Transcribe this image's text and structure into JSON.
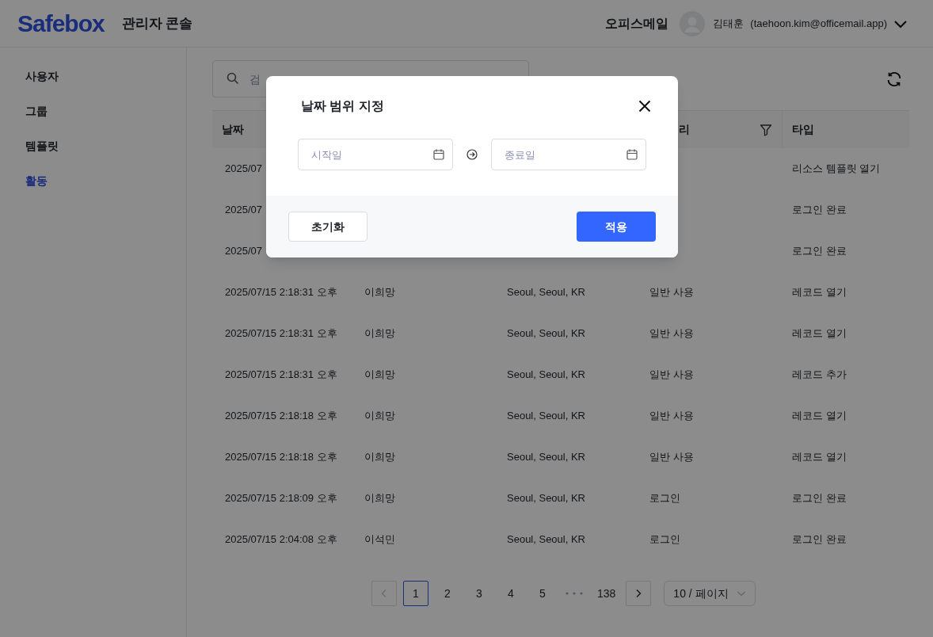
{
  "header": {
    "logo": "Safebox",
    "title": "관리자 콘솔",
    "org": "오피스메일",
    "user_name": "김태훈",
    "user_email": "(taehoon.kim@officemail.app)"
  },
  "sidebar": {
    "items": [
      {
        "label": "사용자",
        "selected": false
      },
      {
        "label": "그룹",
        "selected": false
      },
      {
        "label": "템플릿",
        "selected": false
      },
      {
        "label": "활동",
        "selected": true
      }
    ]
  },
  "search": {
    "placeholder": "검"
  },
  "table": {
    "columns": {
      "date": "날짜",
      "column_4": "리",
      "type": "타입"
    },
    "rows": [
      {
        "date": "2025/07",
        "type": "리소스 템플릿 열기"
      },
      {
        "date": "2025/07",
        "type": "로그인 완료"
      },
      {
        "date": "2025/07",
        "type": "로그인 완료"
      },
      {
        "date": "2025/07/15 2:18:31 오후",
        "user": "이희망",
        "location": "Seoul, Seoul, KR",
        "category": "일반 사용",
        "type": "레코드 열기"
      },
      {
        "date": "2025/07/15 2:18:31 오후",
        "user": "이희망",
        "location": "Seoul, Seoul, KR",
        "category": "일반 사용",
        "type": "레코드 열기"
      },
      {
        "date": "2025/07/15 2:18:31 오후",
        "user": "이희망",
        "location": "Seoul, Seoul, KR",
        "category": "일반 사용",
        "type": "레코드 추가"
      },
      {
        "date": "2025/07/15 2:18:18 오후",
        "user": "이희망",
        "location": "Seoul, Seoul, KR",
        "category": "일반 사용",
        "type": "레코드 열기"
      },
      {
        "date": "2025/07/15 2:18:18 오후",
        "user": "이희망",
        "location": "Seoul, Seoul, KR",
        "category": "일반 사용",
        "type": "레코드 열기"
      },
      {
        "date": "2025/07/15 2:18:09 오후",
        "user": "이희망",
        "location": "Seoul, Seoul, KR",
        "category": "로그인",
        "type": "로그인 완료"
      },
      {
        "date": "2025/07/15 2:04:08 오후",
        "user": "이석민",
        "location": "Seoul, Seoul, KR",
        "category": "로그인",
        "type": "로그인 완료"
      }
    ]
  },
  "pagination": {
    "items": [
      {
        "kind": "prev",
        "disabled": true
      },
      {
        "kind": "page",
        "label": "1",
        "selected": true
      },
      {
        "kind": "page",
        "label": "2",
        "selected": false
      },
      {
        "kind": "page",
        "label": "3",
        "selected": false
      },
      {
        "kind": "page",
        "label": "4",
        "selected": false
      },
      {
        "kind": "page",
        "label": "5",
        "selected": false
      },
      {
        "kind": "ellipsis"
      },
      {
        "kind": "page",
        "label": "138",
        "selected": false
      },
      {
        "kind": "next",
        "disabled": false
      }
    ],
    "page_size": "10 / 페이지"
  },
  "modal": {
    "title": "날짜 범위 지정",
    "start_placeholder": "시작일",
    "end_placeholder": "종료일",
    "reset": "초기화",
    "apply": "적용"
  }
}
